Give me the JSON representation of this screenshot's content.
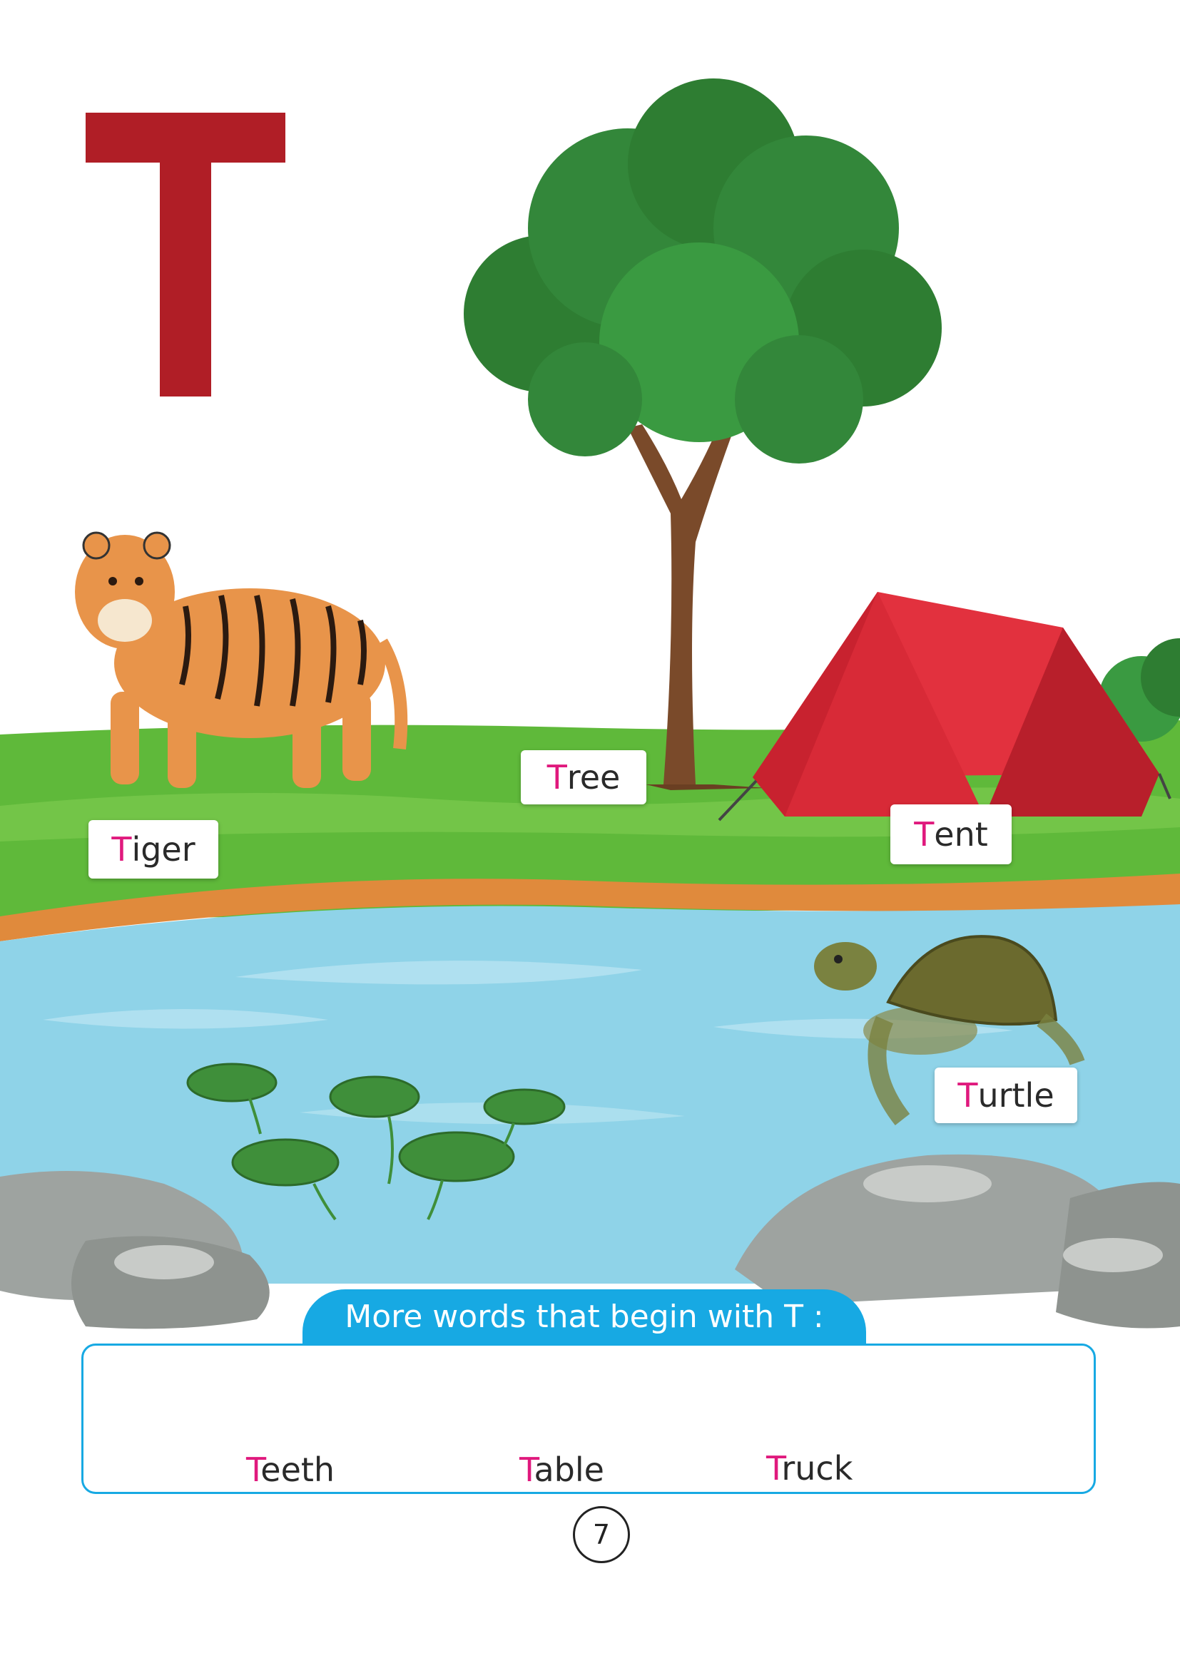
{
  "letter": "T",
  "colors": {
    "letter": "#b01e26",
    "highlight": "#e0197d",
    "banner": "#17a9e3",
    "grass": "#5fb93a",
    "water": "#8fd3e8",
    "tent": "#e2313e"
  },
  "scene_labels": [
    {
      "name": "tiger",
      "first": "T",
      "rest": "iger"
    },
    {
      "name": "tree",
      "first": "T",
      "rest": "ree"
    },
    {
      "name": "tent",
      "first": "T",
      "rest": "ent"
    },
    {
      "name": "turtle",
      "first": "T",
      "rest": "urtle"
    }
  ],
  "more_words": {
    "heading": "More words that begin with T :",
    "items": [
      {
        "name": "teeth",
        "icon": "tooth-icon",
        "first": "T",
        "rest": "eeth"
      },
      {
        "name": "table",
        "icon": "table-icon",
        "first": "T",
        "rest": "able"
      },
      {
        "name": "truck",
        "icon": "truck-icon",
        "first": "T",
        "rest": "ruck"
      }
    ]
  },
  "page_number": "7"
}
